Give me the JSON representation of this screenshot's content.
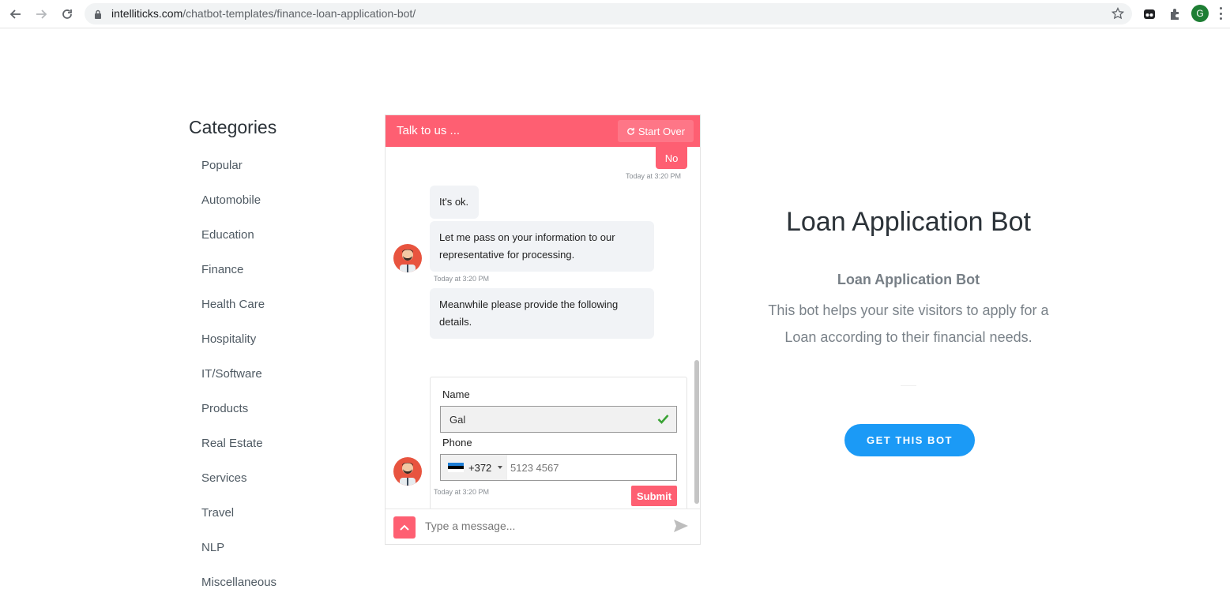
{
  "browser": {
    "url_domain": "intelliticks.com",
    "url_path": "/chatbot-templates/finance-loan-application-bot/",
    "profile_initial": "G"
  },
  "sidebar": {
    "title": "Categories",
    "items": [
      {
        "label": "Popular"
      },
      {
        "label": "Automobile"
      },
      {
        "label": "Education"
      },
      {
        "label": "Finance"
      },
      {
        "label": "Health Care"
      },
      {
        "label": "Hospitality"
      },
      {
        "label": "IT/Software"
      },
      {
        "label": "Products"
      },
      {
        "label": "Real Estate"
      },
      {
        "label": "Services"
      },
      {
        "label": "Travel"
      },
      {
        "label": "NLP"
      },
      {
        "label": "Miscellaneous"
      }
    ]
  },
  "chat": {
    "header_title": "Talk to us ...",
    "start_over_label": "Start Over",
    "user_reply": "No",
    "ts_user": "Today at 3:20 PM",
    "bot_msg_1": "It's ok.",
    "bot_msg_2": "Let me pass on your information to our representative for processing.",
    "ts_bot_1": "Today at 3:20 PM",
    "bot_msg_3": "Meanwhile please provide the following details.",
    "form": {
      "name_label": "Name",
      "name_value": "Gal",
      "phone_label": "Phone",
      "dial_code": "+372",
      "phone_placeholder": "5123 4567",
      "submit_label": "Submit"
    },
    "ts_bot_2": "Today at 3:20 PM",
    "input_placeholder": "Type a message..."
  },
  "main": {
    "title": "Loan Application Bot",
    "subtitle": "Loan Application Bot",
    "description": "This bot helps your site visitors to apply for a Loan according to their financial needs.",
    "cta_label": "GET THIS BOT"
  },
  "colors": {
    "chat_accent": "#fe5f72",
    "cta_blue": "#1b9af6"
  }
}
